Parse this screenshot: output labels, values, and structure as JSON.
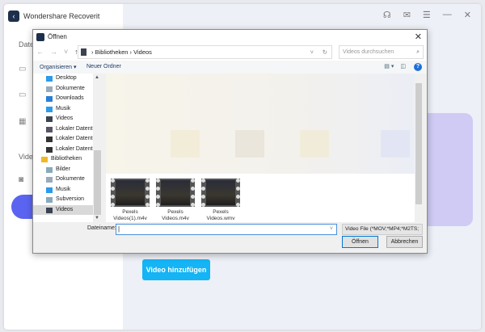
{
  "app": {
    "title": "Wondershare Recoverit",
    "sidebar_fragments": [
      "Datei",
      "Video"
    ],
    "add_video_button": "Video hinzufügen",
    "colors": {
      "accent": "#14b4f5",
      "active": "#5b64f0"
    }
  },
  "dialog": {
    "title": "Öffnen",
    "path": [
      "Bibliotheken",
      "Videos"
    ],
    "search_placeholder": "Videos durchsuchen",
    "toolbar": {
      "organize": "Organisieren ▾",
      "new_folder": "Neuer Ordner"
    },
    "nav_items": [
      {
        "label": "Desktop",
        "icon": "desktop-icon",
        "color": "#2c9be8"
      },
      {
        "label": "Dokumente",
        "icon": "document-icon",
        "color": "#9ab"
      },
      {
        "label": "Downloads",
        "icon": "download-icon",
        "color": "#2a7fd4"
      },
      {
        "label": "Musik",
        "icon": "music-icon",
        "color": "#2c9be8"
      },
      {
        "label": "Videos",
        "icon": "video-icon",
        "color": "#3b4250"
      },
      {
        "label": "Lokaler Datenträger",
        "icon": "drive-icon",
        "color": "#556"
      },
      {
        "label": "Lokaler Datenträger",
        "icon": "drive-icon",
        "color": "#333"
      },
      {
        "label": "Lokaler Datenträger",
        "icon": "drive-icon",
        "color": "#333"
      }
    ],
    "libraries": {
      "label": "Bibliotheken",
      "items": [
        {
          "label": "Bilder",
          "icon": "pictures-icon",
          "color": "#8ab"
        },
        {
          "label": "Dokumente",
          "icon": "document-icon",
          "color": "#9ab"
        },
        {
          "label": "Musik",
          "icon": "music-icon",
          "color": "#2c9be8"
        },
        {
          "label": "Subversion",
          "icon": "subversion-icon",
          "color": "#8ab"
        },
        {
          "label": "Videos",
          "icon": "video-icon",
          "color": "#3b4250"
        }
      ]
    },
    "files": [
      {
        "name": "Pexels Videos(1).m4v"
      },
      {
        "name": "Pexels Videos.m4v"
      },
      {
        "name": "Pexels Videos.wmv"
      }
    ],
    "filename_label": "Dateiname:",
    "filename_value": "",
    "filetype": "Video File (*MOV;*MP4;*M2TS;",
    "open_button": "Öffnen",
    "cancel_button": "Abbrechen"
  }
}
